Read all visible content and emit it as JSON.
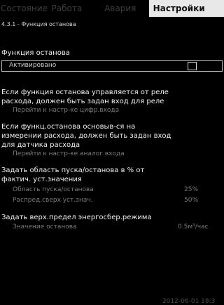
{
  "tabs": [
    {
      "label": "Состояние"
    },
    {
      "label": "Работа"
    },
    {
      "label": "Авария"
    },
    {
      "label": "Настройки"
    }
  ],
  "screen": {
    "title": "4.3.1 - Функция останова"
  },
  "stop_function": {
    "label": "Функция останова",
    "field_value": "Активировано",
    "checked": false
  },
  "relay": {
    "line1": "Если функция останова управляется от реле",
    "line2": "расхода, должен быть задан вход для реле",
    "link": "Перейти к настр-ке цифр.входа"
  },
  "sensor": {
    "line1": "Если функц.останова основыв-ся на",
    "line2": "измерении расхода, должен быть задан вход",
    "line3": "для датчика расхода",
    "link": "Перейти к настр-ке аналог.входа"
  },
  "band": {
    "line1": "Задать область пуска/останова в % от",
    "line2": "фактич. уст.значения",
    "rows": [
      {
        "label": "Область пуска/останова",
        "value": "25%"
      },
      {
        "label": "Распред.сверх уст.знач.",
        "value": "50%"
      }
    ]
  },
  "energy": {
    "line1": "Задать верх.предел энергосбер.режима",
    "row_label": "Значение останова",
    "row_value": "0.5м³/час"
  },
  "footer": {
    "timestamp": "2012-06-01 18:3"
  }
}
